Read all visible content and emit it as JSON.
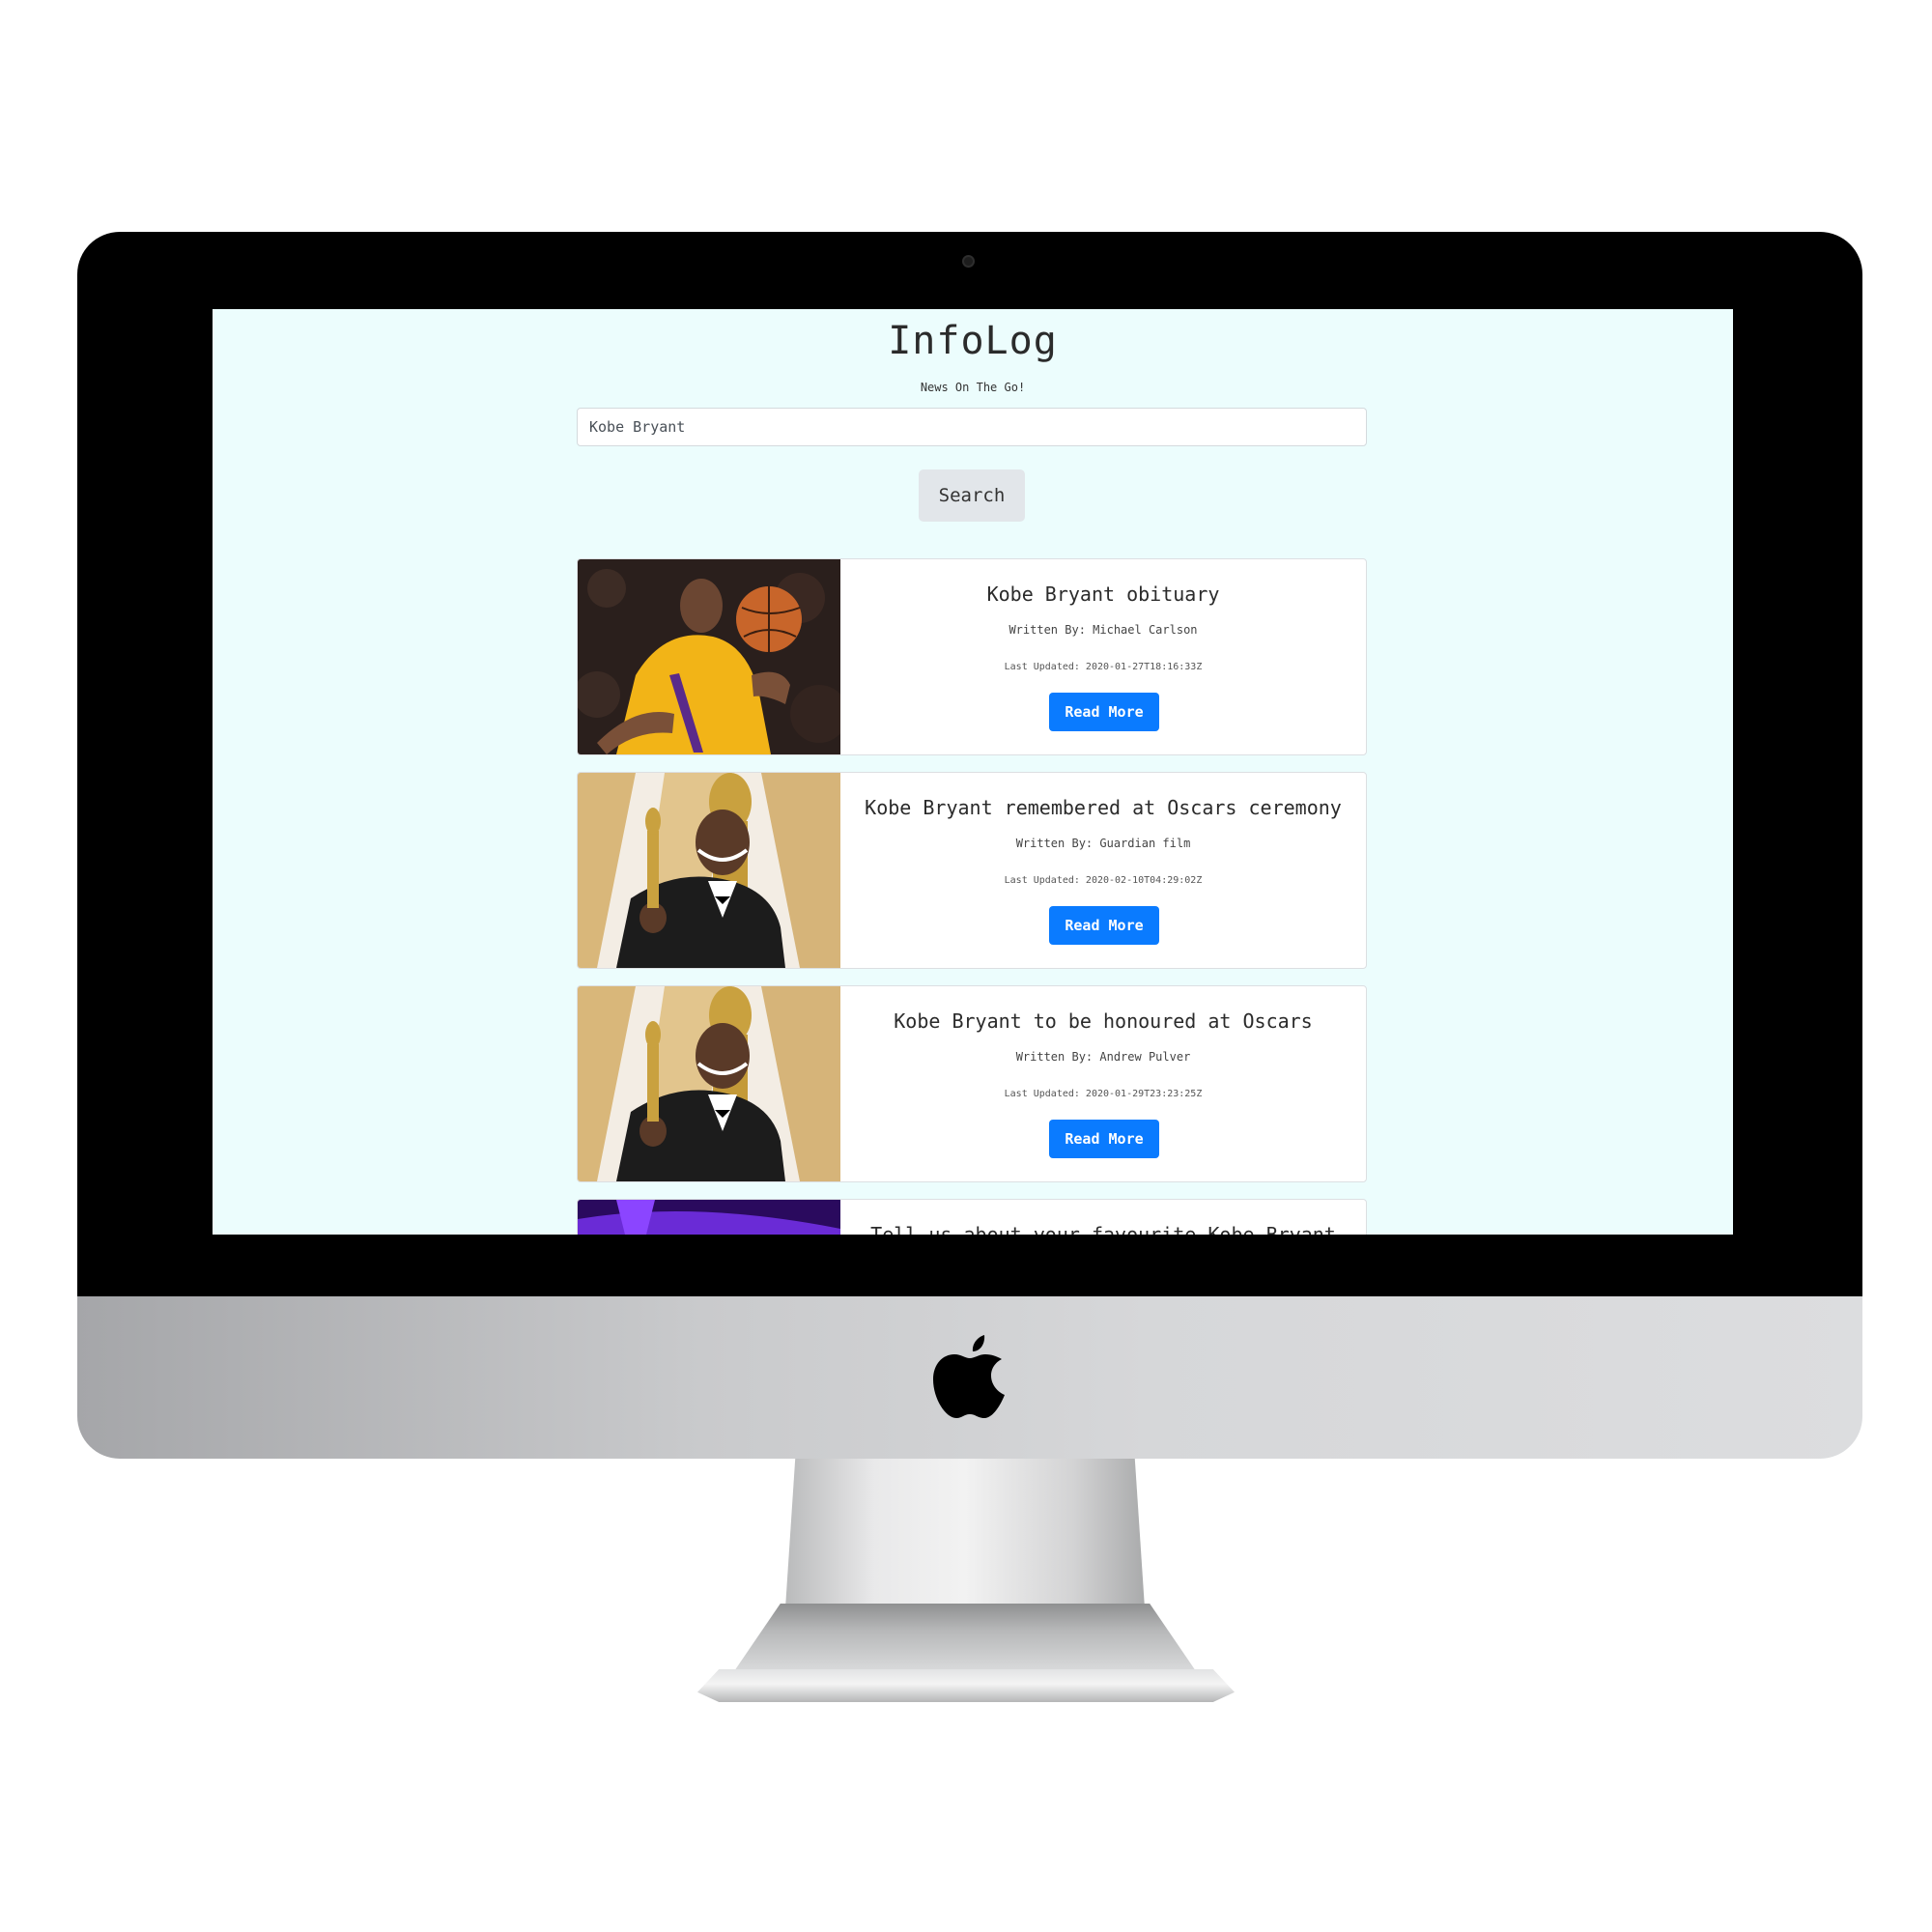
{
  "app": {
    "title": "InfoLog",
    "tagline": "News On The Go!"
  },
  "search": {
    "value": "Kobe Bryant",
    "button_label": "Search"
  },
  "articles": [
    {
      "title": "Kobe Bryant obituary",
      "author": "Written By: Michael Carlson",
      "updated": "Last Updated: 2020-01-27T18:16:33Z",
      "button_label": "Read More",
      "image": "basketball-player-photo"
    },
    {
      "title": "Kobe Bryant remembered at Oscars ceremony",
      "author": "Written By: Guardian film",
      "updated": "Last Updated: 2020-02-10T04:29:02Z",
      "button_label": "Read More",
      "image": "oscar-winner-photo"
    },
    {
      "title": "Kobe Bryant to be honoured at Oscars",
      "author": "Written By: Andrew Pulver",
      "updated": "Last Updated: 2020-01-29T23:23:25Z",
      "button_label": "Read More",
      "image": "oscar-winner-photo"
    },
    {
      "title": "Tell us about your favourite Kobe Bryant",
      "image": "purple-stage-photo"
    }
  ],
  "colors": {
    "page_background": "#ecfdfd",
    "primary_button": "#0a7bff",
    "secondary_button": "#e2e6ea"
  },
  "device": {
    "logo": "apple-logo-icon"
  }
}
